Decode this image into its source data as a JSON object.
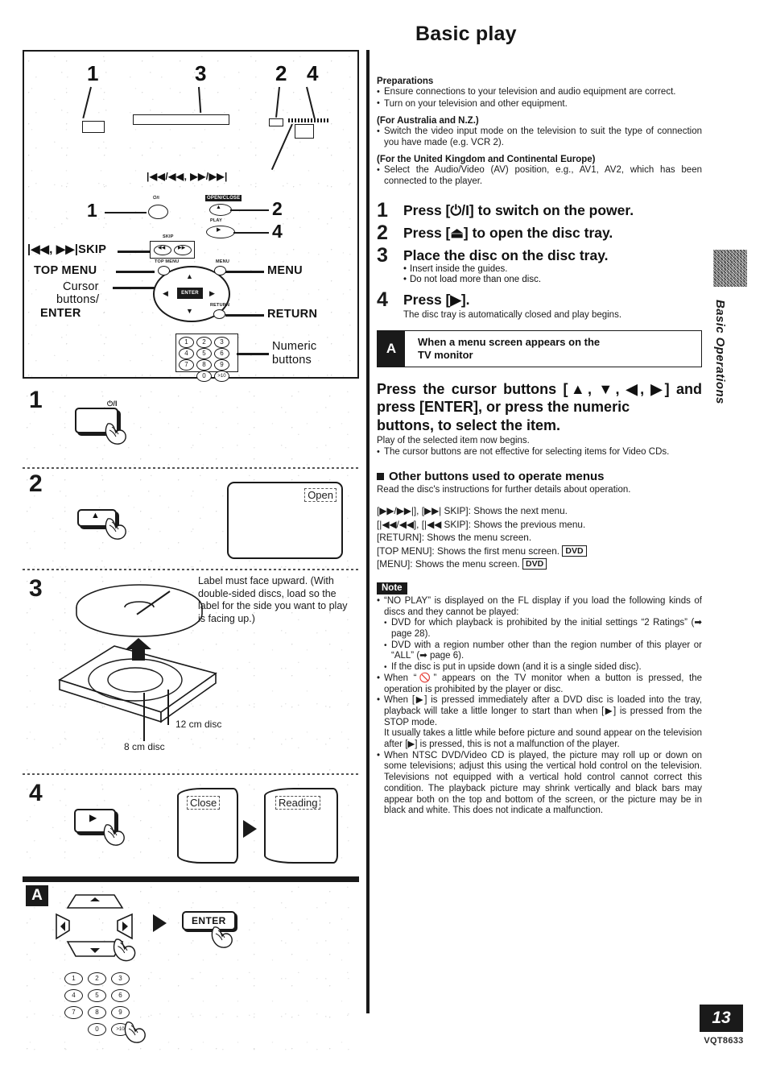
{
  "document": {
    "title": "Basic play",
    "page_number": "13",
    "part_code": "VQT8633",
    "side_tab": "Basic Operations"
  },
  "preparations": {
    "heading": "Preparations",
    "bullets": [
      "Ensure connections to your television and audio equipment are correct.",
      "Turn on your television and other equipment."
    ],
    "regions": [
      {
        "heading": "(For Australia and N.Z.)",
        "bullets": [
          "Switch the video input mode on the television to suit the type of connection you have made (e.g. VCR 2)."
        ]
      },
      {
        "heading": "(For the United Kingdom and Continental Europe)",
        "bullets": [
          "Select the Audio/Video (AV) position, e.g., AV1, AV2, which has been connected to the player."
        ]
      }
    ]
  },
  "steps": [
    {
      "number": "1",
      "heading": "Press [⏻/I] to switch on the power.",
      "sub": "",
      "bullets": []
    },
    {
      "number": "2",
      "heading": "Press [⏏] to open the disc tray.",
      "sub": "",
      "bullets": []
    },
    {
      "number": "3",
      "heading": "Place the disc on the disc tray.",
      "sub": "",
      "bullets": [
        "Insert inside the guides.",
        "Do not load more than one disc."
      ]
    },
    {
      "number": "4",
      "heading": "Press [▶].",
      "sub": "The disc tray is automatically closed and play begins.",
      "bullets": []
    }
  ],
  "callout_a": {
    "marker": "A",
    "line1": "When a menu screen appears on the",
    "line2": "TV monitor"
  },
  "cursor_section": {
    "heading_line1": "Press the cursor buttons [▲, ▼, ◀, ▶]",
    "heading_line2": "and press [ENTER], or press the numeric",
    "heading_line3": "buttons, to select the item.",
    "plain": "Play of the selected item now begins.",
    "bullet": "The cursor buttons are not effective for selecting items for Video CDs."
  },
  "other_buttons": {
    "heading": "Other buttons used to operate menus",
    "intro": "Read the disc's instructions for further details about operation.",
    "rows": [
      {
        "keys": "[▶▶/▶▶|], [▶▶| SKIP]:",
        "desc": "Shows the next menu.",
        "badge": ""
      },
      {
        "keys": "[|◀◀/◀◀], [|◀◀ SKIP]:",
        "desc": "Shows the previous menu.",
        "badge": ""
      },
      {
        "keys": "[RETURN]:",
        "desc": "Shows the menu screen.",
        "badge": ""
      },
      {
        "keys": "[TOP MENU]:",
        "desc": "Shows the first menu screen.",
        "badge": "DVD"
      },
      {
        "keys": "[MENU]:",
        "desc": "Shows the menu screen.",
        "badge": "DVD"
      }
    ]
  },
  "note": {
    "tag": "Note",
    "items": [
      {
        "level": 1,
        "text": "“NO PLAY” is displayed on the FL display if you load the following kinds of discs and they cannot be played:"
      },
      {
        "level": 2,
        "text": "DVD for which playback is prohibited by the initial settings “2 Ratings” (➡ page 28)."
      },
      {
        "level": 2,
        "text": "DVD with a region number other than the region number of this player or “ALL” (➡ page 6)."
      },
      {
        "level": 2,
        "text": "If the disc is put in upside down (and it is a single sided disc)."
      },
      {
        "level": 1,
        "text": "When “🚫” appears on the TV monitor when a button is pressed, the operation is prohibited by the player or disc."
      },
      {
        "level": 1,
        "text": "When [▶] is pressed immediately after a DVD disc is loaded into the tray, playback will take a little longer to start than when [▶] is pressed from the STOP mode."
      },
      {
        "level": 0,
        "text": "It usually takes a little while before picture and sound appear on the television after [▶] is pressed, this is not a malfunction of the player."
      },
      {
        "level": 1,
        "text": "When NTSC DVD/Video CD is played, the picture may roll up or down on some televisions; adjust this using the vertical hold control on the television. Televisions not equipped with a vertical hold control cannot correct this condition. The playback picture may shrink vertically and black bars may appear both on the top and bottom of the screen, or the picture may be in black and white. This does not indicate a malfunction."
      }
    ]
  },
  "diagram": {
    "front_panel_callouts": [
      "1",
      "3",
      "2",
      "4"
    ],
    "front_panel_skip_label": "|◀◀/◀◀,  ▶▶/▶▶|",
    "remote_callouts": {
      "power": "1",
      "open_close": "2",
      "play": "4"
    },
    "remote_button_labels": {
      "power": "⏻/I",
      "open_close": "OPEN/CLOSE",
      "play": "PLAY",
      "skip": "SKIP",
      "top_menu": "TOP MENU",
      "menu": "MENU",
      "return": "RETURN",
      "enter": "ENTER"
    },
    "remote_labels": {
      "skip": "|◀◀, ▶▶|SKIP",
      "top_menu": "TOP MENU",
      "cursor_line1": "Cursor",
      "cursor_line2": "buttons/",
      "cursor_line3": "ENTER",
      "menu": "MENU",
      "return": "RETURN",
      "numeric_line1": "Numeric",
      "numeric_line2": "buttons"
    },
    "keypad": [
      "1",
      "2",
      "3",
      "4",
      "5",
      "6",
      "7",
      "8",
      "9",
      "0",
      ">10"
    ],
    "step_panels": {
      "s1": {
        "number": "1",
        "button_label": "⏻/I"
      },
      "s2": {
        "number": "2",
        "button_label": "⏏",
        "osd": "Open"
      },
      "s3": {
        "number": "3",
        "note": "Label must face upward. (With double-sided discs, load so the label for the side you want to play is facing up.)",
        "caption_12cm": "12 cm disc",
        "caption_8cm": "8 cm disc"
      },
      "s4": {
        "number": "4",
        "button_label": "▶",
        "osd1": "Close",
        "osd2": "Reading"
      },
      "a": {
        "marker": "A",
        "enter_label": "ENTER"
      }
    }
  }
}
